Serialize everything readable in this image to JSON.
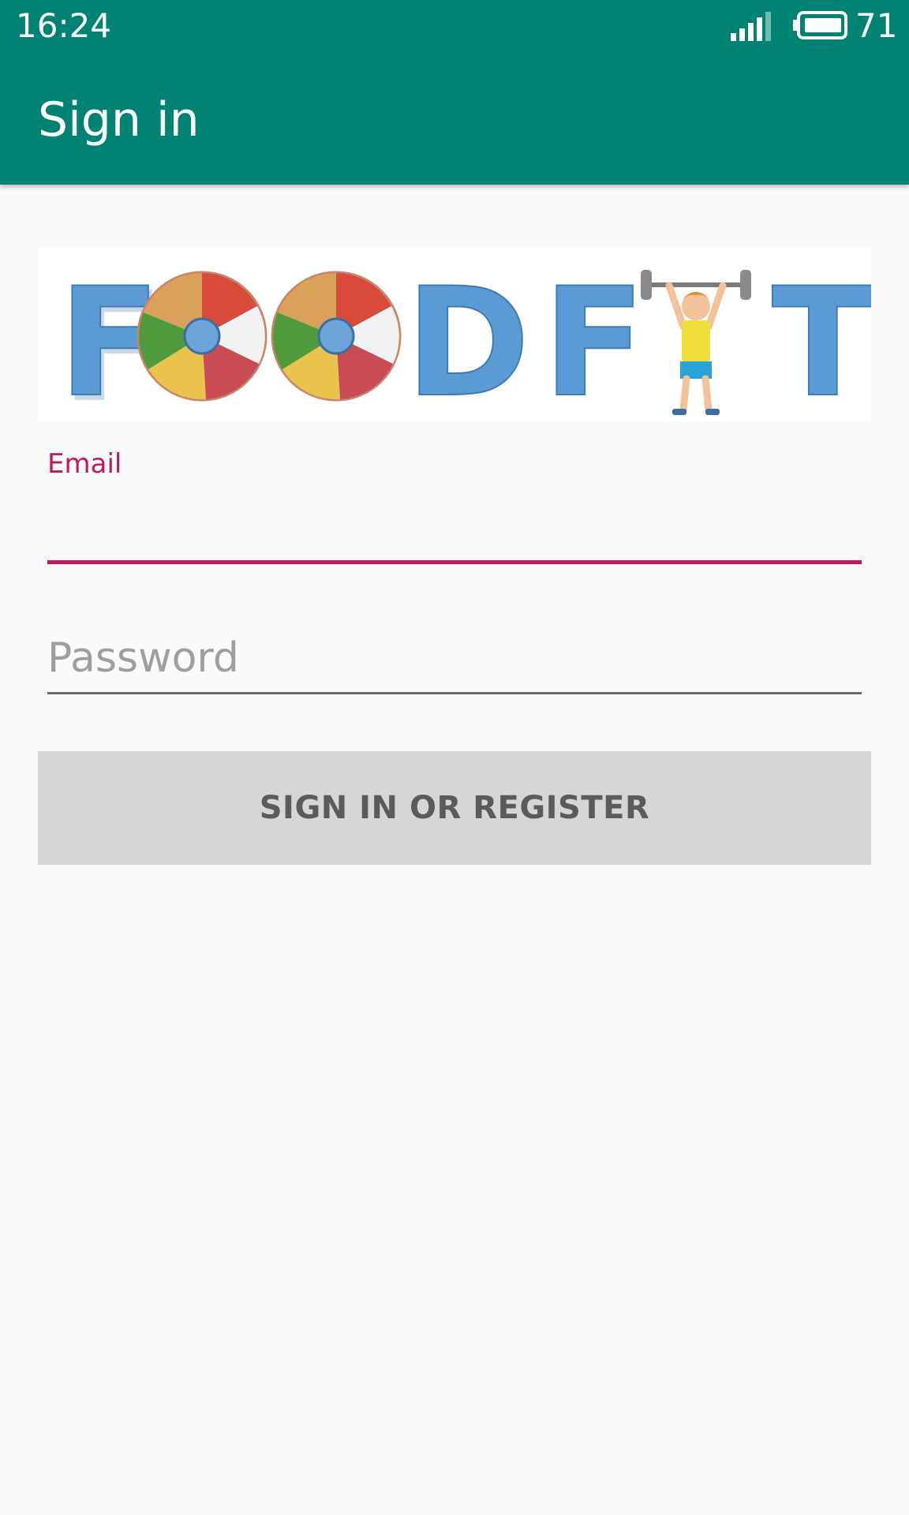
{
  "status_bar": {
    "time": "16:24",
    "battery": "71",
    "signal_icon": "signal-bars-icon",
    "battery_icon": "battery-icon"
  },
  "app_bar": {
    "title": "Sign in"
  },
  "logo": {
    "text": "FOOD FIT",
    "icon": "food-fit-logo"
  },
  "form": {
    "email_label": "Email",
    "email_value": "",
    "password_placeholder": "Password",
    "password_value": "",
    "submit_label": "SIGN IN OR REGISTER"
  },
  "colors": {
    "primary": "#018374",
    "accent": "#c2185b",
    "background": "#fafafa",
    "button": "#d6d6d6",
    "logo_letters": "#5b9bd5"
  }
}
